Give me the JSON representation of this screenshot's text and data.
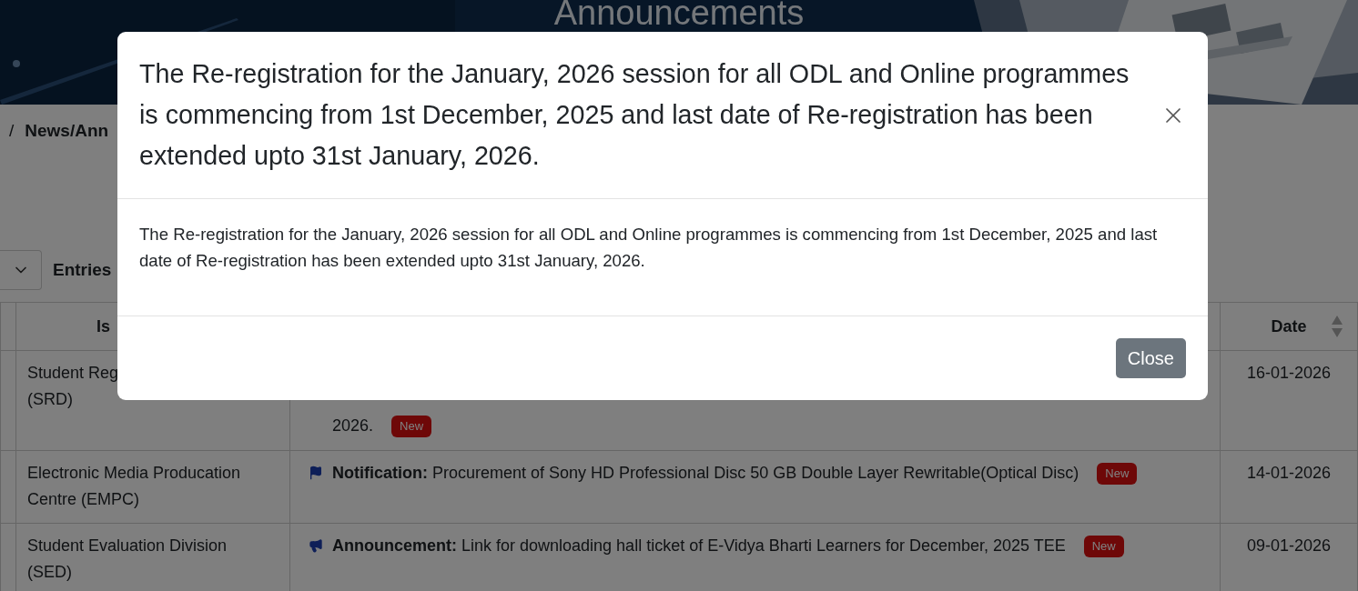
{
  "banner": {
    "title": "Announcements"
  },
  "breadcrumb": {
    "separator": "/",
    "current": "News/Ann"
  },
  "entries_control": {
    "label": "Entries"
  },
  "table": {
    "columns": [
      {
        "label": "Is"
      },
      {
        "label": "Date"
      }
    ],
    "rows": [
      {
        "issuer_lines": [
          "Student Reg",
          "(SRD)"
        ],
        "description": {
          "kind": "plain",
          "text": "2026.",
          "badge": "New"
        },
        "date": "16-01-2026"
      },
      {
        "issuer_lines": [
          "Electronic Media Producation",
          "Centre (EMPC)"
        ],
        "description": {
          "kind": "notification",
          "text": "**Notification:** Procurement of Sony HD Professional Disc 50 GB Double Layer Rewritable(Optical Disc)",
          "badge": "New"
        },
        "date": "14-01-2026"
      },
      {
        "issuer_lines": [
          "Student Evaluation Division",
          "(SED)"
        ],
        "description": {
          "kind": "announcement",
          "text": "**Announcement:** Link for downloading hall ticket of E-Vidya Bharti Learners for December, 2025 TEE",
          "badge": "New"
        },
        "date": "09-01-2026"
      }
    ]
  },
  "modal": {
    "title": "The Re-registration for the January, 2026 session for all ODL and Online programmes is commencing from 1st December, 2025 and last date of Re-registration has been extended upto 31st January, 2026.",
    "body": "The Re-registration for the January, 2026 session for all ODL and Online programmes is commencing from 1st December, 2025 and last date of Re-registration has been extended upto 31st January, 2026.",
    "close_button": "Close"
  }
}
